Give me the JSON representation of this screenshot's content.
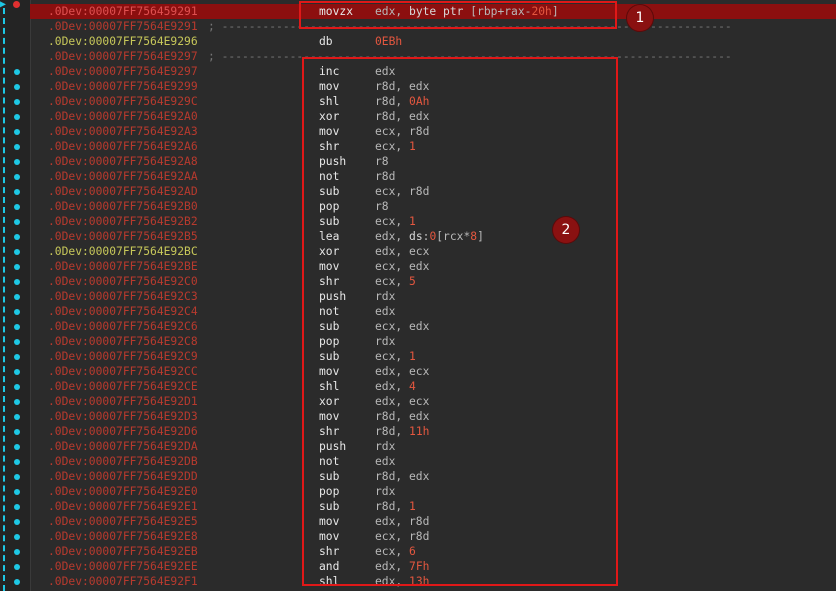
{
  "colors": {
    "background": "#2b2b2b",
    "address": "#b83a2e",
    "address_highlight": "#c8c85a",
    "breakpoint_row": "#8c0f0f",
    "number": "#e4573f",
    "gutter_line": "#1ec8e6",
    "annotation": "#e01818"
  },
  "gutter_icons": [
    "arrow-icon",
    "breakpoint-icon"
  ],
  "annotations": {
    "box1_label": "1",
    "box2_label": "2"
  },
  "rows": [
    {
      "addr": ".0Dev:00007FF756459291",
      "mn": "movzx",
      "ops": "edx, byte ptr [rbp+rax-20h]",
      "type": "bp"
    },
    {
      "addr": ".0Dev:00007FF7564E9291",
      "sep": "; ---------------------------------------------------------------------------"
    },
    {
      "addr": ".0Dev:00007FF7564E9296",
      "mn": "db",
      "ops": "0EBh",
      "type": "normal"
    },
    {
      "addr": ".0Dev:00007FF7564E9297",
      "sep": "; ---------------------------------------------------------------------------"
    },
    {
      "addr": ".0Dev:00007FF7564E9297",
      "mn": "inc",
      "ops": "edx"
    },
    {
      "addr": ".0Dev:00007FF7564E9299",
      "mn": "mov",
      "ops": "r8d, edx"
    },
    {
      "addr": ".0Dev:00007FF7564E929C",
      "mn": "shl",
      "ops": "r8d, 0Ah"
    },
    {
      "addr": ".0Dev:00007FF7564E92A0",
      "mn": "xor",
      "ops": "r8d, edx"
    },
    {
      "addr": ".0Dev:00007FF7564E92A3",
      "mn": "mov",
      "ops": "ecx, r8d"
    },
    {
      "addr": ".0Dev:00007FF7564E92A6",
      "mn": "shr",
      "ops": "ecx, 1"
    },
    {
      "addr": ".0Dev:00007FF7564E92A8",
      "mn": "push",
      "ops": "r8"
    },
    {
      "addr": ".0Dev:00007FF7564E92AA",
      "mn": "not",
      "ops": "r8d"
    },
    {
      "addr": ".0Dev:00007FF7564E92AD",
      "mn": "sub",
      "ops": "ecx, r8d"
    },
    {
      "addr": ".0Dev:00007FF7564E92B0",
      "mn": "pop",
      "ops": "r8"
    },
    {
      "addr": ".0Dev:00007FF7564E92B2",
      "mn": "sub",
      "ops": "ecx, 1"
    },
    {
      "addr": ".0Dev:00007FF7564E92B5",
      "mn": "lea",
      "ops": "edx, ds:0[rcx*8]"
    },
    {
      "addr": ".0Dev:00007FF7564E92BC",
      "mn": "xor",
      "ops": "edx, ecx",
      "type": "normal"
    },
    {
      "addr": ".0Dev:00007FF7564E92BE",
      "mn": "mov",
      "ops": "ecx, edx"
    },
    {
      "addr": ".0Dev:00007FF7564E92C0",
      "mn": "shr",
      "ops": "ecx, 5"
    },
    {
      "addr": ".0Dev:00007FF7564E92C3",
      "mn": "push",
      "ops": "rdx"
    },
    {
      "addr": ".0Dev:00007FF7564E92C4",
      "mn": "not",
      "ops": "edx"
    },
    {
      "addr": ".0Dev:00007FF7564E92C6",
      "mn": "sub",
      "ops": "ecx, edx"
    },
    {
      "addr": ".0Dev:00007FF7564E92C8",
      "mn": "pop",
      "ops": "rdx"
    },
    {
      "addr": ".0Dev:00007FF7564E92C9",
      "mn": "sub",
      "ops": "ecx, 1"
    },
    {
      "addr": ".0Dev:00007FF7564E92CC",
      "mn": "mov",
      "ops": "edx, ecx"
    },
    {
      "addr": ".0Dev:00007FF7564E92CE",
      "mn": "shl",
      "ops": "edx, 4"
    },
    {
      "addr": ".0Dev:00007FF7564E92D1",
      "mn": "xor",
      "ops": "edx, ecx"
    },
    {
      "addr": ".0Dev:00007FF7564E92D3",
      "mn": "mov",
      "ops": "r8d, edx"
    },
    {
      "addr": ".0Dev:00007FF7564E92D6",
      "mn": "shr",
      "ops": "r8d, 11h"
    },
    {
      "addr": ".0Dev:00007FF7564E92DA",
      "mn": "push",
      "ops": "rdx"
    },
    {
      "addr": ".0Dev:00007FF7564E92DB",
      "mn": "not",
      "ops": "edx"
    },
    {
      "addr": ".0Dev:00007FF7564E92DD",
      "mn": "sub",
      "ops": "r8d, edx"
    },
    {
      "addr": ".0Dev:00007FF7564E92E0",
      "mn": "pop",
      "ops": "rdx"
    },
    {
      "addr": ".0Dev:00007FF7564E92E1",
      "mn": "sub",
      "ops": "r8d, 1"
    },
    {
      "addr": ".0Dev:00007FF7564E92E5",
      "mn": "mov",
      "ops": "edx, r8d"
    },
    {
      "addr": ".0Dev:00007FF7564E92E8",
      "mn": "mov",
      "ops": "ecx, r8d"
    },
    {
      "addr": ".0Dev:00007FF7564E92EB",
      "mn": "shr",
      "ops": "ecx, 6"
    },
    {
      "addr": ".0Dev:00007FF7564E92EE",
      "mn": "and",
      "ops": "edx, 7Fh"
    },
    {
      "addr": ".0Dev:00007FF7564E92F1",
      "mn": "shl",
      "ops": "edx, 13h"
    }
  ]
}
